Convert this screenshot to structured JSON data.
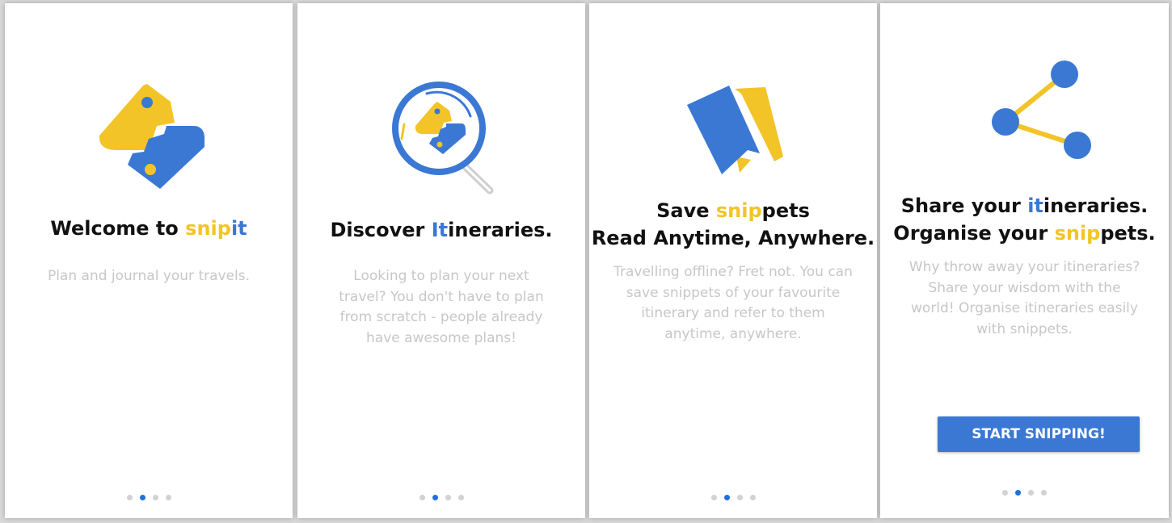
{
  "screens": [
    {
      "title": {
        "before": "Welcome to ",
        "snip": "snip",
        "it": "it"
      },
      "description": "Plan and journal your travels.",
      "pager": {
        "active": 2,
        "total": 4
      }
    },
    {
      "title": {
        "before": "Discover ",
        "highlight": "It",
        "after": "ineraries."
      },
      "description": "Looking to plan your next travel? You don't have to plan from scratch - people already have awesome plans!",
      "pager": {
        "active": 2,
        "total": 4
      }
    },
    {
      "title_line1": {
        "before": "Save ",
        "highlight": "snip",
        "after": "pets"
      },
      "title_line2": "Read Anytime, Anywhere.",
      "description": "Travelling offline? Fret not. You can save snippets of your favourite itinerary and refer to them anytime, anywhere.",
      "pager": {
        "active": 2,
        "total": 4
      }
    },
    {
      "title_line1": {
        "before": "Share your ",
        "highlight": "it",
        "after": "ineraries."
      },
      "title_line2": {
        "before": "Organise your ",
        "highlight": "snip",
        "after": "pets."
      },
      "description": "Why throw away your itineraries? Share your wisdom with the world! Organise itineraries easily with snippets.",
      "button": "START SNIPPING!",
      "pager": {
        "active": 2,
        "total": 4
      }
    }
  ],
  "colors": {
    "yellow": "#f2c428",
    "blue": "#3a78d4",
    "active_dot": "#1f6fde",
    "grey": "#c7c7c7"
  },
  "icons": [
    "snipit-logo-icon",
    "magnifier-icon",
    "bookmark-icon",
    "share-icon"
  ]
}
